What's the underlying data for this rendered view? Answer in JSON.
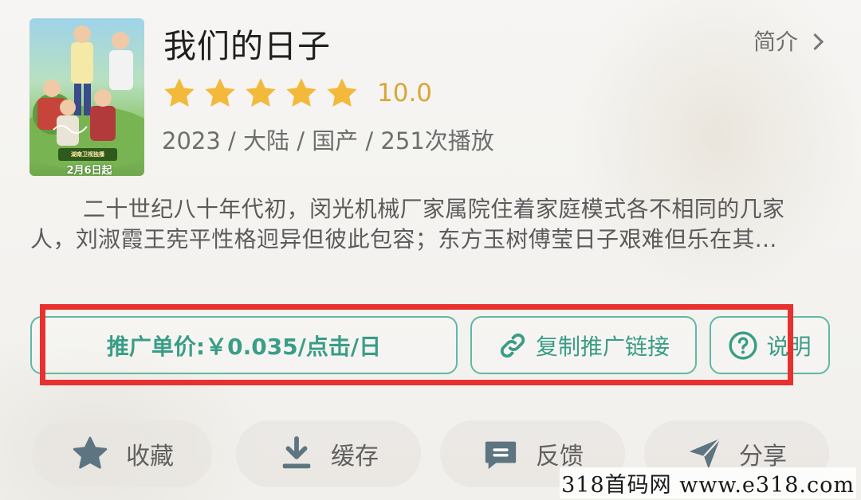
{
  "movie": {
    "title": "我们的日子",
    "intro_label": "简介",
    "rating": 10.0,
    "rating_text": "10.0",
    "stars": 5,
    "meta": "2023 / 大陆 / 国产 / 251次播放",
    "description": "二十世纪八十年代初，闵光机械厂家属院住着家庭模式各不相同的几家人，刘淑霞王宪平性格迥异但彼此包容；东方玉树傅莹日子艰难但乐在其...",
    "poster": {
      "banner_text": "湖南卫视独播",
      "date_text": "2月6日起"
    }
  },
  "actions": {
    "price_label": "推广单价:￥0.035/点击/日",
    "copy_link_label": "复制推广链接",
    "help_label": "说明"
  },
  "tools": {
    "favorite": "收藏",
    "cache": "缓存",
    "feedback": "反馈",
    "share": "分享"
  },
  "watermark": "318首码网  www.e318.com",
  "colors": {
    "accent": "#3a9d86",
    "star": "#f2b93b",
    "score": "#d8a63a",
    "highlight": "#e8312f"
  }
}
